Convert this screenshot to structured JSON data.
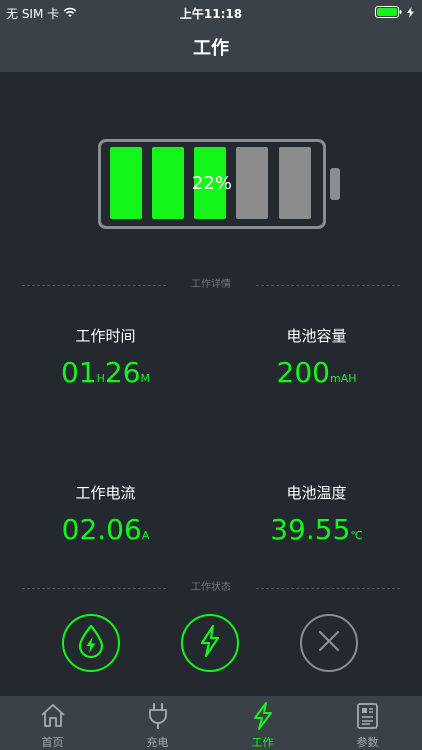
{
  "status_bar": {
    "carrier": "无 SIM 卡",
    "time": "上午11:18"
  },
  "nav": {
    "title": "工作"
  },
  "battery": {
    "percent_label": "22%",
    "cells_total": 5,
    "cells_on": 3,
    "fill_color": "#14f51a",
    "empty_color": "#8c8c8c"
  },
  "details": {
    "section_label": "工作详情",
    "work_time": {
      "label": "工作时间",
      "hours": "01",
      "h_unit": "H",
      "minutes": "26",
      "m_unit": "M"
    },
    "capacity": {
      "label": "电池容量",
      "value": "200",
      "unit": "mAH"
    },
    "current": {
      "label": "工作电流",
      "value": "02.06",
      "unit": "A"
    },
    "temperature": {
      "label": "电池温度",
      "value": "39.55",
      "unit": "℃"
    }
  },
  "status": {
    "section_label": "工作状态",
    "buttons": [
      {
        "icon": "drop-bolt-icon"
      },
      {
        "icon": "bolt-icon"
      },
      {
        "icon": "close-icon"
      }
    ]
  },
  "tabs": [
    {
      "label": "首页",
      "icon": "home-icon"
    },
    {
      "label": "充电",
      "icon": "plug-icon"
    },
    {
      "label": "工作",
      "icon": "bolt-icon",
      "active": true
    },
    {
      "label": "参数",
      "icon": "document-icon"
    }
  ],
  "colors": {
    "accent": "#14f51a",
    "background": "#23292f",
    "bar": "#3a4149"
  }
}
